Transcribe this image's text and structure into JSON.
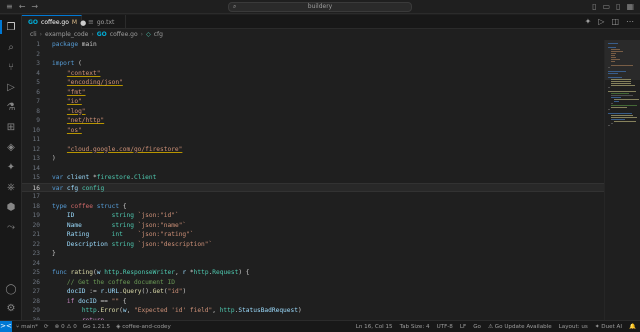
{
  "titlebar": {
    "command_center": "buildery",
    "search_icon": "search-icon"
  },
  "tabs": [
    {
      "icon": "GO",
      "label": "coffee.go",
      "badge": "M",
      "active": true
    },
    {
      "icon": "≡",
      "label": "go.txt",
      "active": false
    }
  ],
  "breadcrumb": {
    "items": [
      "cli",
      "example_code",
      "coffee.go",
      "cfg"
    ],
    "go_icon": "GO",
    "var_icon": "◇"
  },
  "editor": {
    "current_line": 16,
    "lines": [
      {
        "n": "1"
      },
      {
        "n": "2"
      },
      {
        "n": "3"
      },
      {
        "n": "4"
      },
      {
        "n": "5"
      },
      {
        "n": "6"
      },
      {
        "n": "7"
      },
      {
        "n": "8"
      },
      {
        "n": "9"
      },
      {
        "n": "10"
      },
      {
        "n": "11"
      },
      {
        "n": "12"
      },
      {
        "n": "13"
      },
      {
        "n": "14"
      },
      {
        "n": "15"
      },
      {
        "n": "16"
      },
      {
        "n": "17"
      },
      {
        "n": "18"
      },
      {
        "n": "19"
      },
      {
        "n": "20"
      },
      {
        "n": "21"
      },
      {
        "n": "22"
      },
      {
        "n": "23"
      },
      {
        "n": "24"
      },
      {
        "n": "25"
      },
      {
        "n": "26"
      },
      {
        "n": "27"
      },
      {
        "n": "28"
      },
      {
        "n": "29"
      },
      {
        "n": "30"
      },
      {
        "n": "31"
      },
      {
        "n": "32"
      },
      {
        "n": "33"
      },
      {
        "n": "34"
      },
      {
        "n": "35"
      },
      {
        "n": "36"
      },
      {
        "n": "37"
      },
      {
        "n": "38"
      },
      {
        "n": "39"
      }
    ]
  },
  "statusbar": {
    "remote": "><",
    "branch": "main*",
    "sync": "⟳",
    "errors": "⊗ 0 ⚠ 0",
    "go_version": "Go 1.21.5",
    "project": "coffee-and-codey",
    "position": "Ln 16, Col 15",
    "tab_size": "Tab Size: 4",
    "encoding": "UTF-8",
    "eol": "LF",
    "language": "Go",
    "update": "Go Update Available",
    "layout": "Layout: us",
    "duet": "Duet AI",
    "bell": "🔔"
  },
  "colors": {
    "accent": "#0078d4",
    "keyword": "#569cd6",
    "string": "#ce9178",
    "function": "#dcdcaa",
    "type": "#4ec9b0",
    "variable": "#9cdcfe",
    "comment": "#6a9955"
  }
}
